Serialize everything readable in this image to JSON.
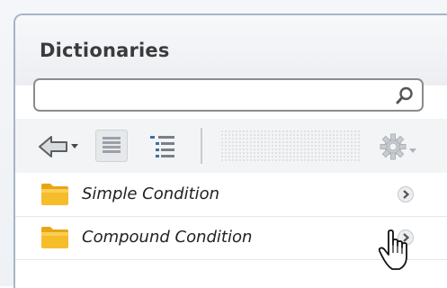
{
  "panel": {
    "title": "Dictionaries"
  },
  "search": {
    "value": "",
    "placeholder": "",
    "icon": "search-icon"
  },
  "toolbar": {
    "back_icon": "back-arrow-dropdown-icon",
    "list_view_icon": "list-view-icon",
    "tree_view_icon": "tree-view-icon",
    "settings_icon": "gear-dropdown-icon"
  },
  "items": [
    {
      "label": "Simple Condition",
      "icon": "folder-icon"
    },
    {
      "label": "Compound Condition",
      "icon": "folder-icon"
    }
  ],
  "colors": {
    "folder": "#f2b81c",
    "title": "#3b3b3b",
    "border": "#a9b4c2"
  }
}
